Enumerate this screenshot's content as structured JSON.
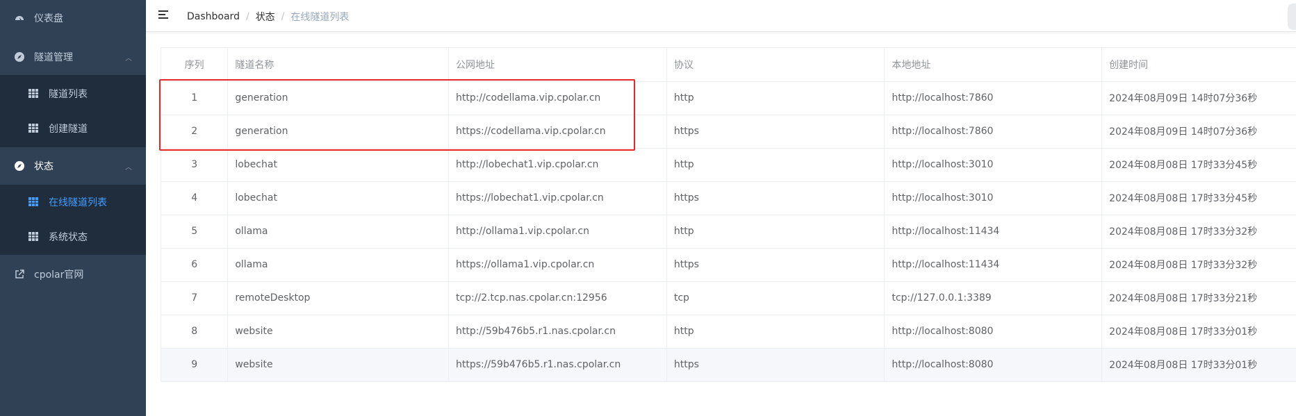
{
  "sidebar": {
    "dashboard": "仪表盘",
    "tunnel_mgmt": "隧道管理",
    "tunnel_list": "隧道列表",
    "create_tunnel": "创建隧道",
    "status": "状态",
    "online_tunnels": "在线隧道列表",
    "system_status": "系统状态",
    "cpolar_site": "cpolar官网"
  },
  "breadcrumb": {
    "root": "Dashboard",
    "sep1": "/",
    "status": "状态",
    "sep2": "/",
    "current": "在线隧道列表"
  },
  "table": {
    "headers": [
      "序列",
      "隧道名称",
      "公网地址",
      "协议",
      "本地地址",
      "创建时间"
    ],
    "rows": [
      [
        "1",
        "generation",
        "http://codellama.vip.cpolar.cn",
        "http",
        "http://localhost:7860",
        "2024年08月09日 14时07分36秒"
      ],
      [
        "2",
        "generation",
        "https://codellama.vip.cpolar.cn",
        "https",
        "http://localhost:7860",
        "2024年08月09日 14时07分36秒"
      ],
      [
        "3",
        "lobechat",
        "http://lobechat1.vip.cpolar.cn",
        "http",
        "http://localhost:3010",
        "2024年08月08日 17时33分45秒"
      ],
      [
        "4",
        "lobechat",
        "https://lobechat1.vip.cpolar.cn",
        "https",
        "http://localhost:3010",
        "2024年08月08日 17时33分45秒"
      ],
      [
        "5",
        "ollama",
        "http://ollama1.vip.cpolar.cn",
        "http",
        "http://localhost:11434",
        "2024年08月08日 17时33分32秒"
      ],
      [
        "6",
        "ollama",
        "https://ollama1.vip.cpolar.cn",
        "https",
        "http://localhost:11434",
        "2024年08月08日 17时33分32秒"
      ],
      [
        "7",
        "remoteDesktop",
        "tcp://2.tcp.nas.cpolar.cn:12956",
        "tcp",
        "tcp://127.0.0.1:3389",
        "2024年08月08日 17时33分21秒"
      ],
      [
        "8",
        "website",
        "http://59b476b5.r1.nas.cpolar.cn",
        "http",
        "http://localhost:8080",
        "2024年08月08日 17时33分01秒"
      ],
      [
        "9",
        "website",
        "https://59b476b5.r1.nas.cpolar.cn",
        "https",
        "http://localhost:8080",
        "2024年08月08日 17时33分01秒"
      ]
    ]
  },
  "colors": {
    "sidebar_bg": "#304156",
    "submenu_bg": "#1f2d3d",
    "active": "#409eff",
    "highlight": "#e8262a"
  }
}
